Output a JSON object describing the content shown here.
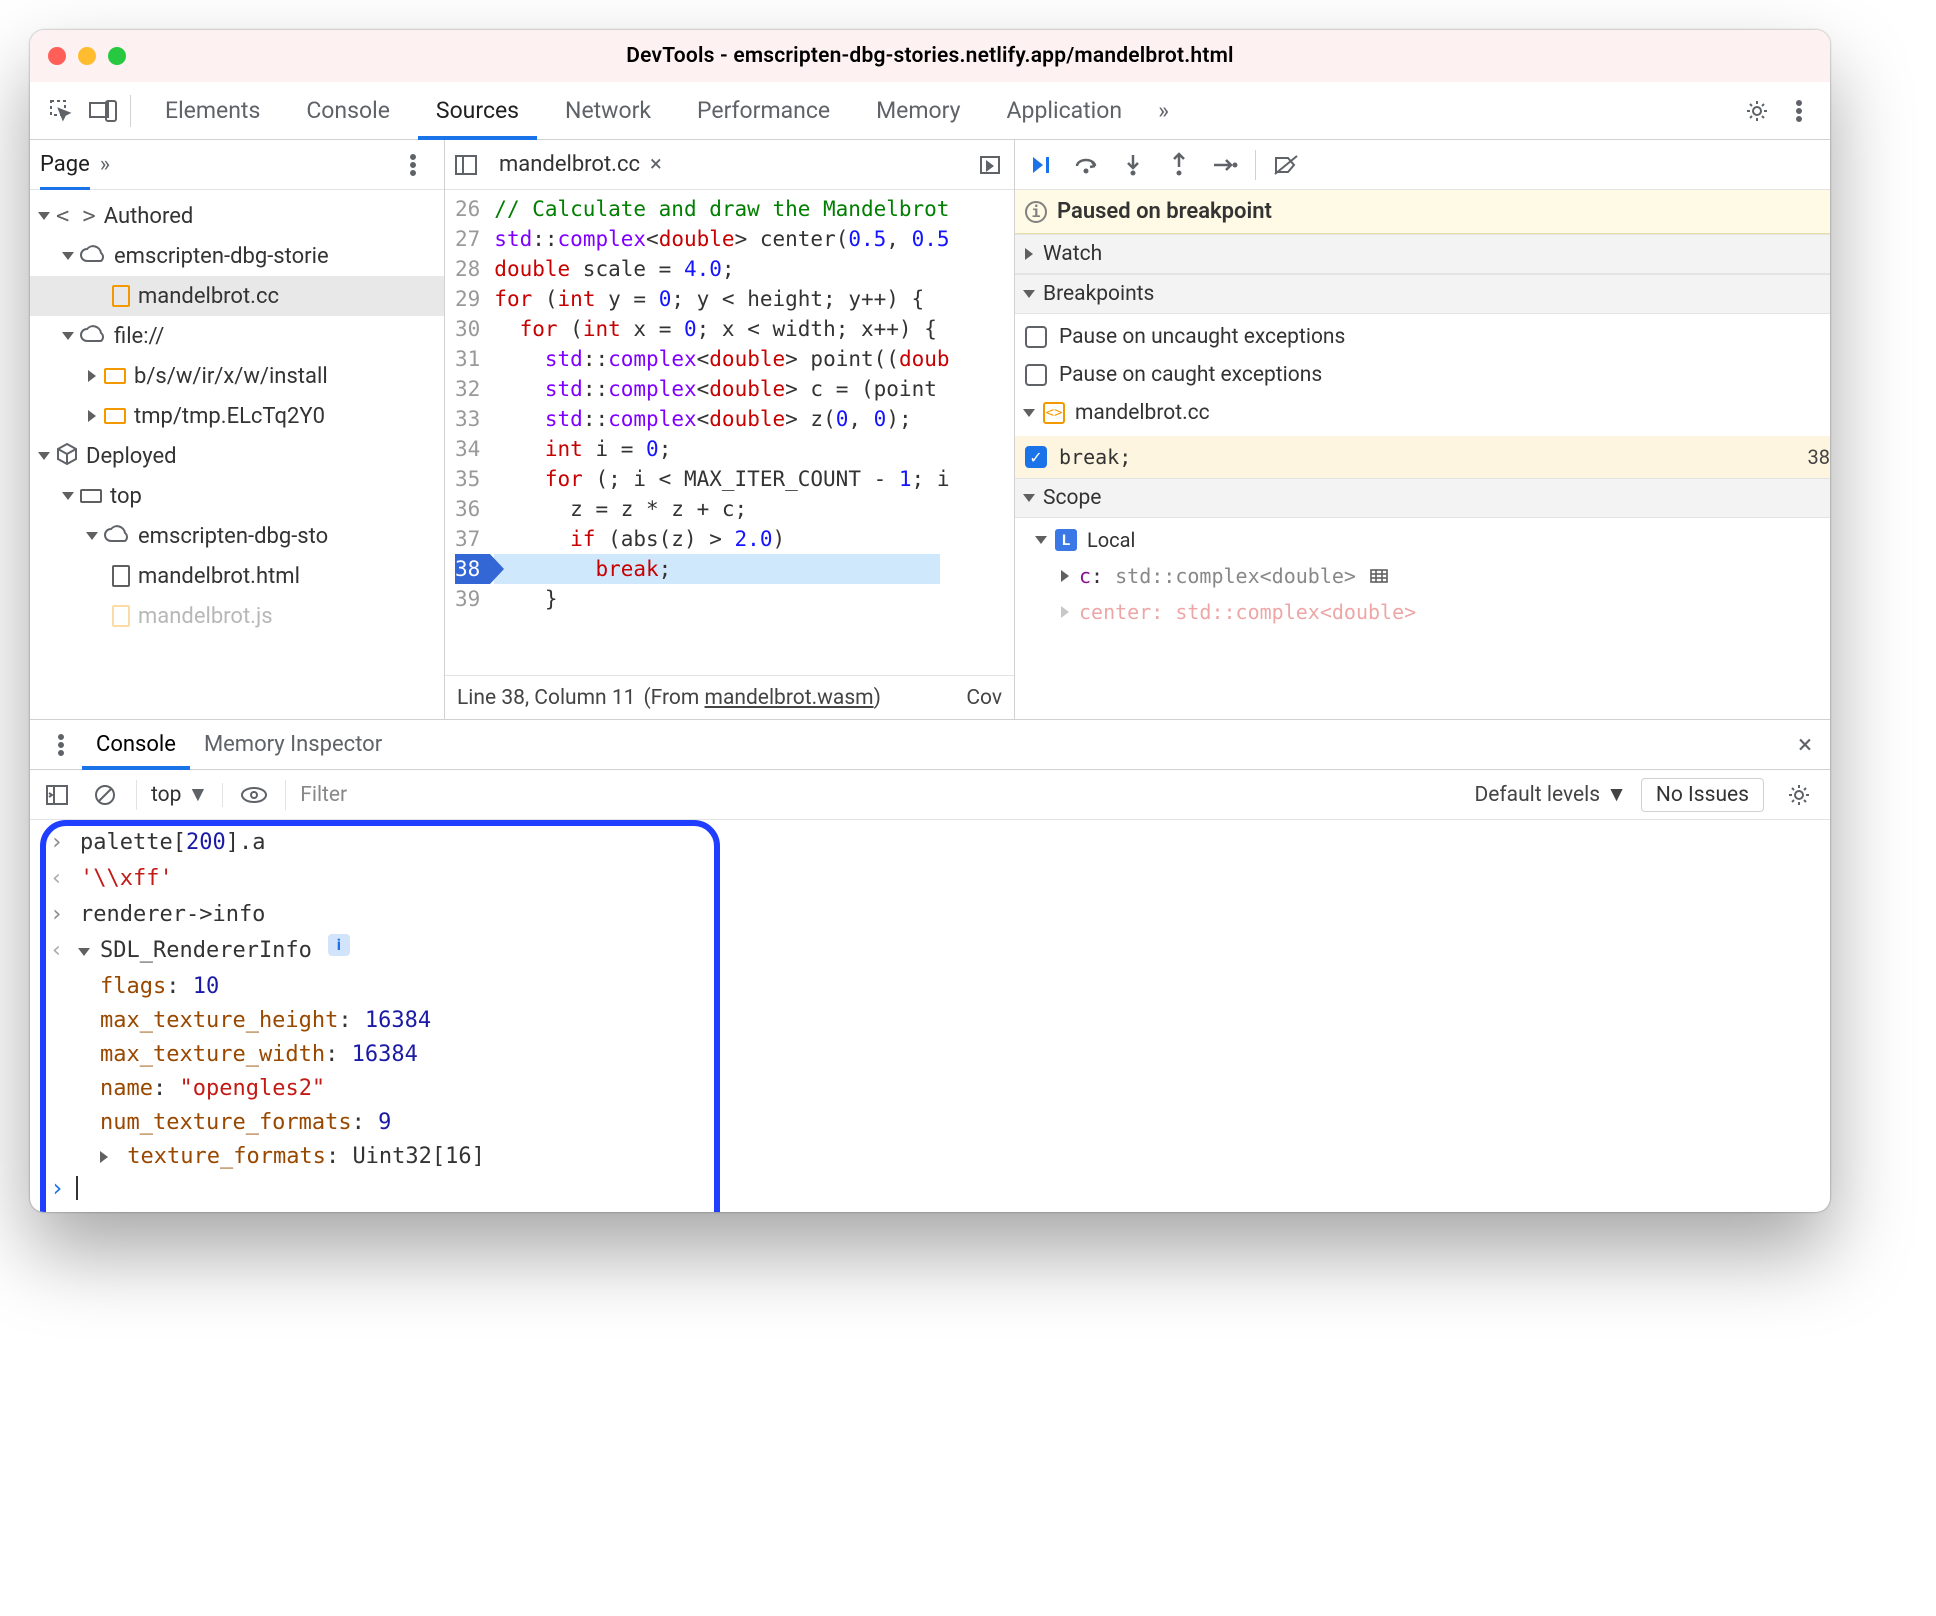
{
  "window": {
    "title": "DevTools - emscripten-dbg-stories.netlify.app/mandelbrot.html"
  },
  "tabs": {
    "list": [
      "Elements",
      "Console",
      "Sources",
      "Network",
      "Performance",
      "Memory",
      "Application"
    ],
    "active": "Sources",
    "overflow": "»"
  },
  "navigator": {
    "header_tab": "Page",
    "overflow": "»",
    "groups": {
      "authored": "Authored",
      "authored_site": "emscripten-dbg-storie",
      "authored_file": "mandelbrot.cc",
      "file_scheme": "file://",
      "file_path1": "b/s/w/ir/x/w/install",
      "file_path2": "tmp/tmp.ELcTq2Y0",
      "deployed": "Deployed",
      "top": "top",
      "deployed_site": "emscripten-dbg-sto",
      "deployed_file1": "mandelbrot.html",
      "deployed_file2": "mandelbrot.js"
    }
  },
  "editor": {
    "tab_name": "mandelbrot.cc",
    "close_glyph": "×",
    "status": {
      "line": 38,
      "column": 11,
      "from": "mandelbrot.wasm",
      "cov": "Cov"
    },
    "first_line_no": 26,
    "active_line_no": 38
  },
  "debugger": {
    "pause_text": "Paused on breakpoint",
    "section_watch": "Watch",
    "section_breakpoints": "Breakpoints",
    "uncaught": "Pause on uncaught exceptions",
    "caught": "Pause on caught exceptions",
    "bp_file": "mandelbrot.cc",
    "bp_code": "break;",
    "bp_line": 38,
    "section_scope": "Scope",
    "scope_local": "Local",
    "scope_var1": {
      "name": "c",
      "type": "std::complex<double>"
    },
    "scope_var2_hint": "center:  std::complex<double>"
  },
  "drawer": {
    "tabs": [
      "Console",
      "Memory Inspector"
    ],
    "active": "Console",
    "toolbar": {
      "context": "top",
      "filter_placeholder": "Filter",
      "levels": "Default levels",
      "issues": "No Issues"
    },
    "entries": {
      "e1_in": "palette[200].a",
      "e1_in_idx": "200",
      "e1_out": "'\\\\xff'",
      "e2_in": "renderer->info",
      "e2_type": "SDL_RendererInfo",
      "obj": {
        "flags": 10,
        "max_texture_height": 16384,
        "max_texture_width": 16384,
        "name": "\"opengles2\"",
        "num_texture_formats": 9,
        "texture_formats": "Uint32[16]"
      }
    }
  }
}
